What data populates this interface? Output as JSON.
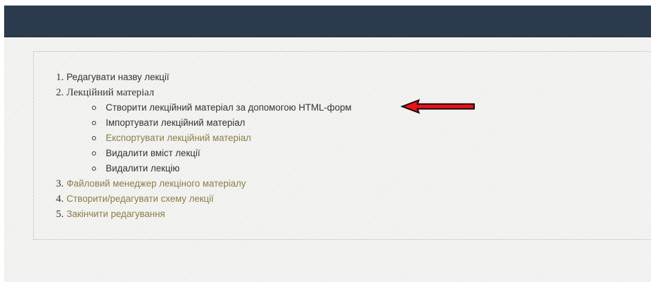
{
  "menu": {
    "items": [
      {
        "num": "1.",
        "label": "Редагувати назву лекції"
      },
      {
        "num": "2.",
        "label": "Лекційний матеріал"
      },
      {
        "num": "3.",
        "label": "Файловий менеджер лекціного матеріалу"
      },
      {
        "num": "4.",
        "label": "Створити/редагувати схему лекції"
      },
      {
        "num": "5.",
        "label": "Закінчити редагування"
      }
    ],
    "subitems": [
      {
        "label": "Створити лекційний матеріал за допомогою HTML-форм"
      },
      {
        "label": "Імпортувати лекційний матеріал"
      },
      {
        "label": "Експортувати лекційний матеріал"
      },
      {
        "label": "Видалити вміст лекції"
      },
      {
        "label": "Видалити лекцію"
      }
    ]
  },
  "colors": {
    "header": "#2c3a4e",
    "text": "#333333",
    "link": "#8a7d47",
    "arrow_fill": "#e8141c",
    "arrow_stroke": "#1a0606"
  },
  "icons": {
    "bullet": "hollow-circle-bullet",
    "annotation": "red-arrow-pointing-left"
  }
}
